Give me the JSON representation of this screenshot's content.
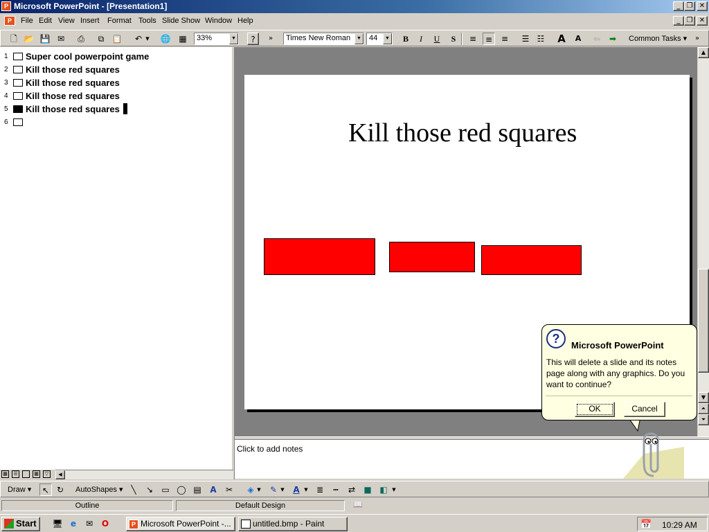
{
  "window": {
    "title": "Microsoft PowerPoint - [Presentation1]"
  },
  "menu": [
    "File",
    "Edit",
    "View",
    "Insert",
    "Format",
    "Tools",
    "Slide Show",
    "Window",
    "Help"
  ],
  "toolbar": {
    "zoom": "33%",
    "font": "Times New Roman",
    "size": "44",
    "common_tasks": "Common Tasks"
  },
  "outline": [
    {
      "num": "1",
      "text": "Super cool powerpoint game"
    },
    {
      "num": "2",
      "text": "Kill those red squares"
    },
    {
      "num": "3",
      "text": "Kill those red squares"
    },
    {
      "num": "4",
      "text": "Kill those red squares"
    },
    {
      "num": "5",
      "text": "Kill those red squares"
    },
    {
      "num": "6",
      "text": ""
    }
  ],
  "slide": {
    "title": "Kill those red squares",
    "square_color": "#ff0000"
  },
  "notes": {
    "placeholder": "Click to add notes"
  },
  "drawbar": {
    "draw": "Draw",
    "autoshapes": "AutoShapes"
  },
  "status": {
    "view": "Outline",
    "design": "Default Design"
  },
  "balloon": {
    "title": "Microsoft PowerPoint",
    "message": "This will delete a slide and its notes page along with any graphics. Do you want to continue?",
    "ok": "OK",
    "cancel": "Cancel"
  },
  "taskbar": {
    "start": "Start",
    "tasks": [
      "Microsoft PowerPoint -...",
      "untitled.bmp - Paint"
    ],
    "clock": "10:29 AM"
  }
}
